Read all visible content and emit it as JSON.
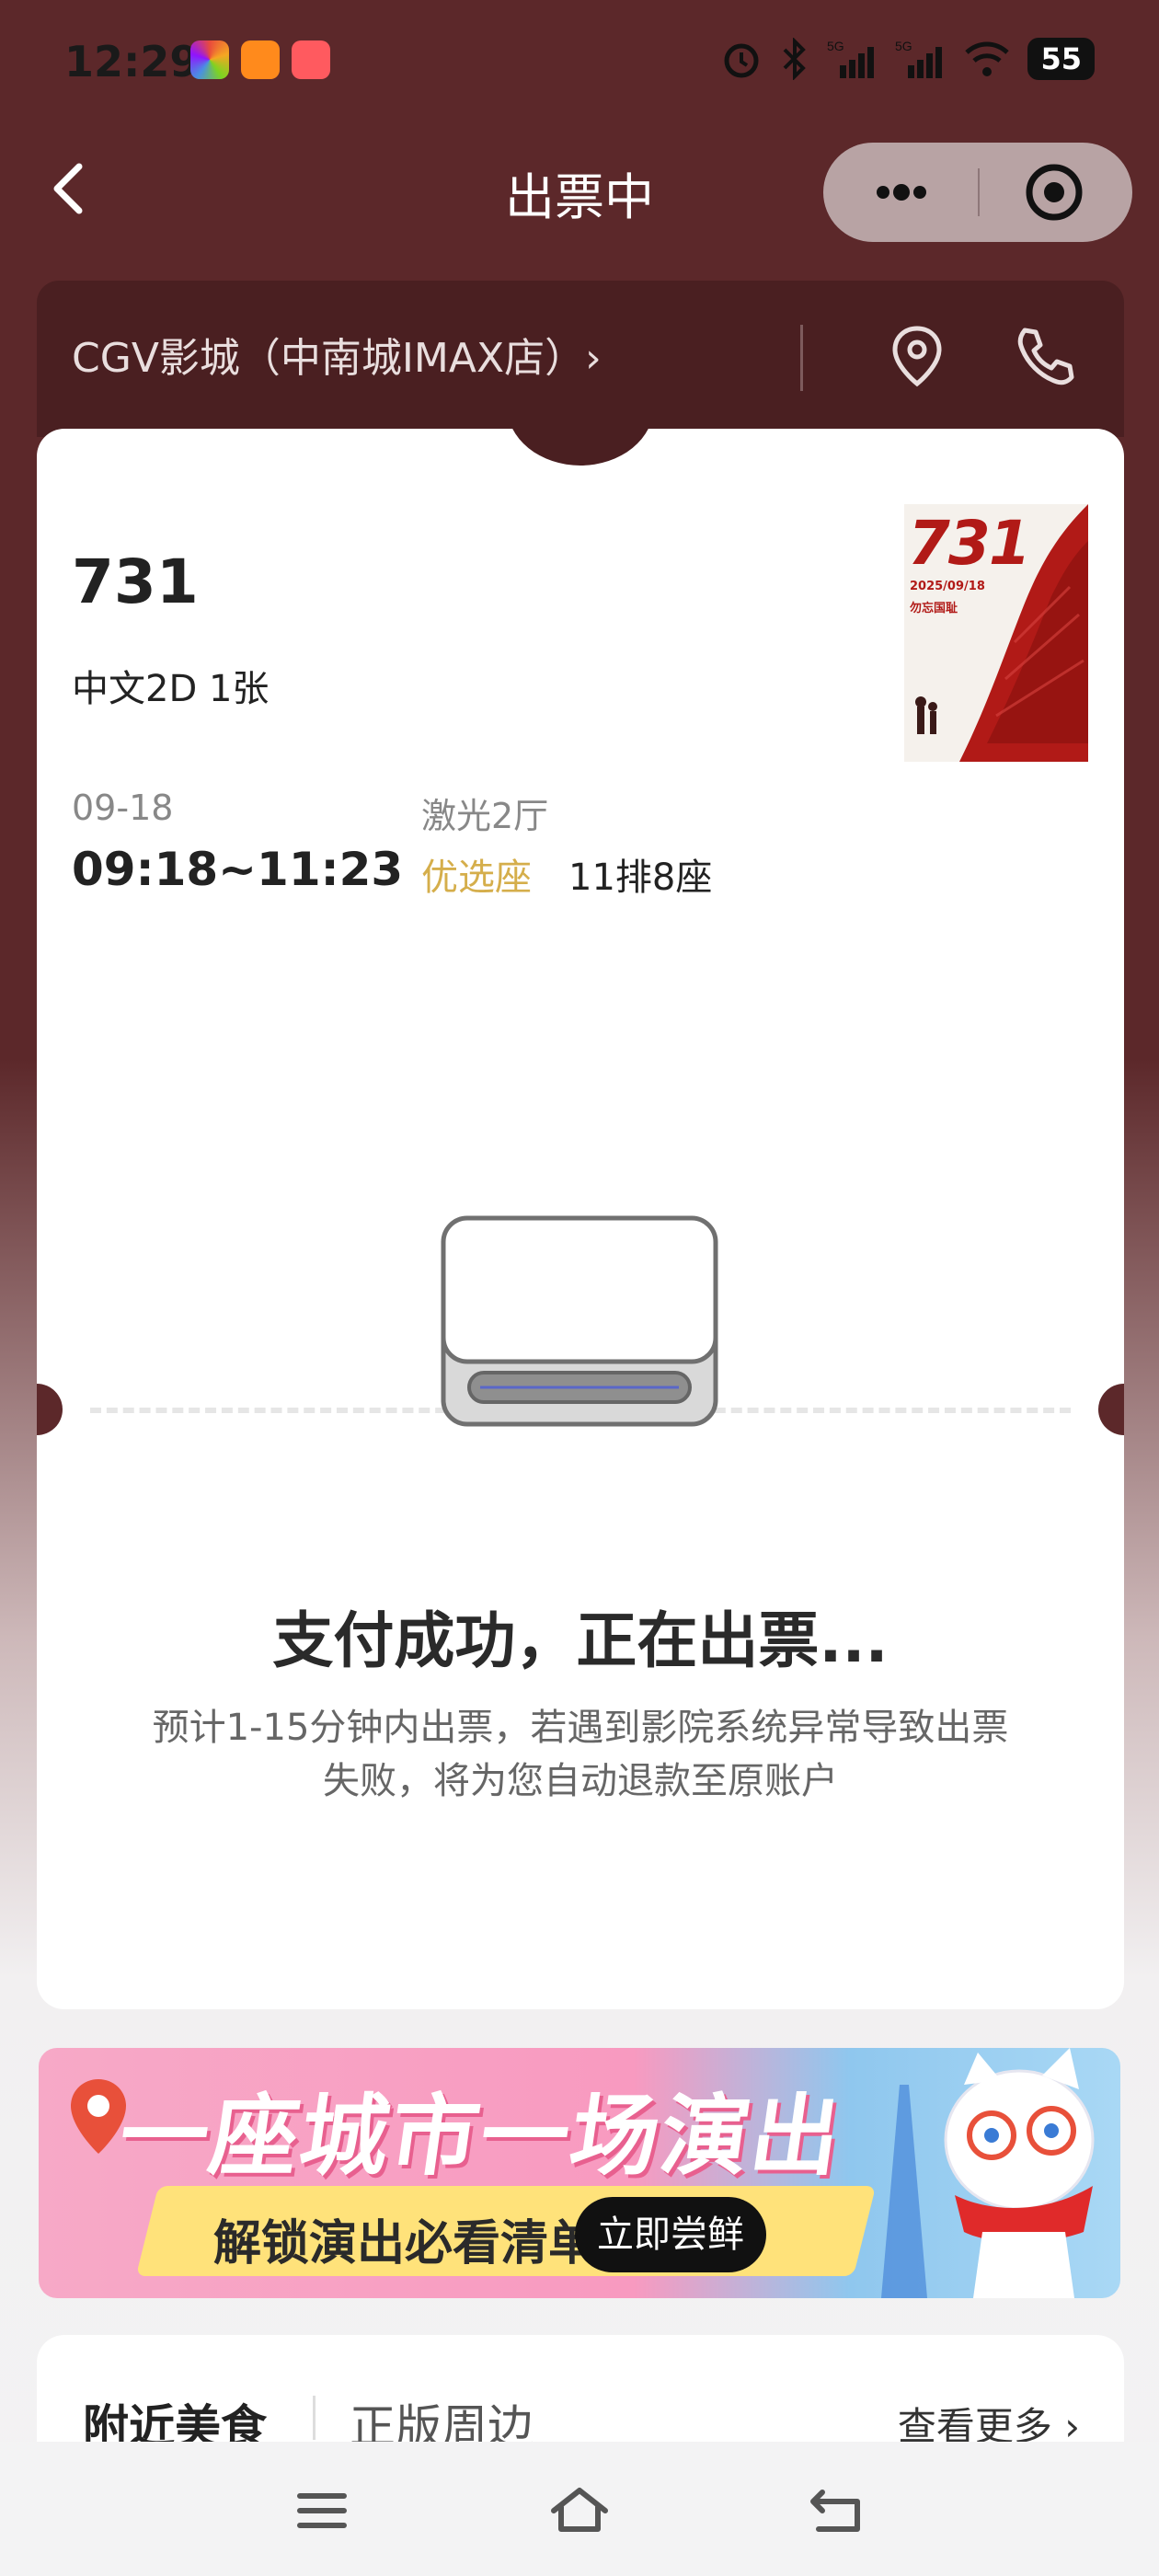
{
  "status_bar": {
    "time": "12:29",
    "battery": "55",
    "icons": [
      "alarm-icon",
      "bluetooth-icon",
      "signal-5g-icon",
      "signal-5g-icon",
      "wifi-icon"
    ]
  },
  "nav": {
    "title": "出票中",
    "back_icon": "chevron-left-icon",
    "more_icon": "more-dots-icon",
    "close_icon": "target-icon"
  },
  "cinema": {
    "name": "CGV影城（中南城IMAX店）›",
    "location_icon": "location-pin-icon",
    "phone_icon": "phone-icon"
  },
  "movie": {
    "title": "731",
    "format": "中文2D 1张",
    "date": "09-18",
    "time": "09:18~11:23",
    "hall": "激光2厅",
    "seat_type": "优选座",
    "seat": "11排8座",
    "poster": {
      "title": "731",
      "date": "2025/09/18",
      "subtitle": "勿忘国耻"
    }
  },
  "status": {
    "text": "支付成功，正在出票...",
    "description": "预计1-15分钟内出票，若遇到影院系统异常导致出票失败，将为您自动退款至原账户"
  },
  "banner": {
    "title": "一座城市一场演出",
    "subtitle": "解锁演出必看清单",
    "button": "立即尝鲜"
  },
  "recommend": {
    "tab_food": "附近美食",
    "tab_merch": "正版周边",
    "more": "查看更多 ›"
  },
  "system_nav": [
    "menu-icon",
    "home-icon",
    "back-icon"
  ],
  "colors": {
    "theme": "#5c282a",
    "accent_gold": "#d5ae4b",
    "poster_red": "#b11a17"
  }
}
